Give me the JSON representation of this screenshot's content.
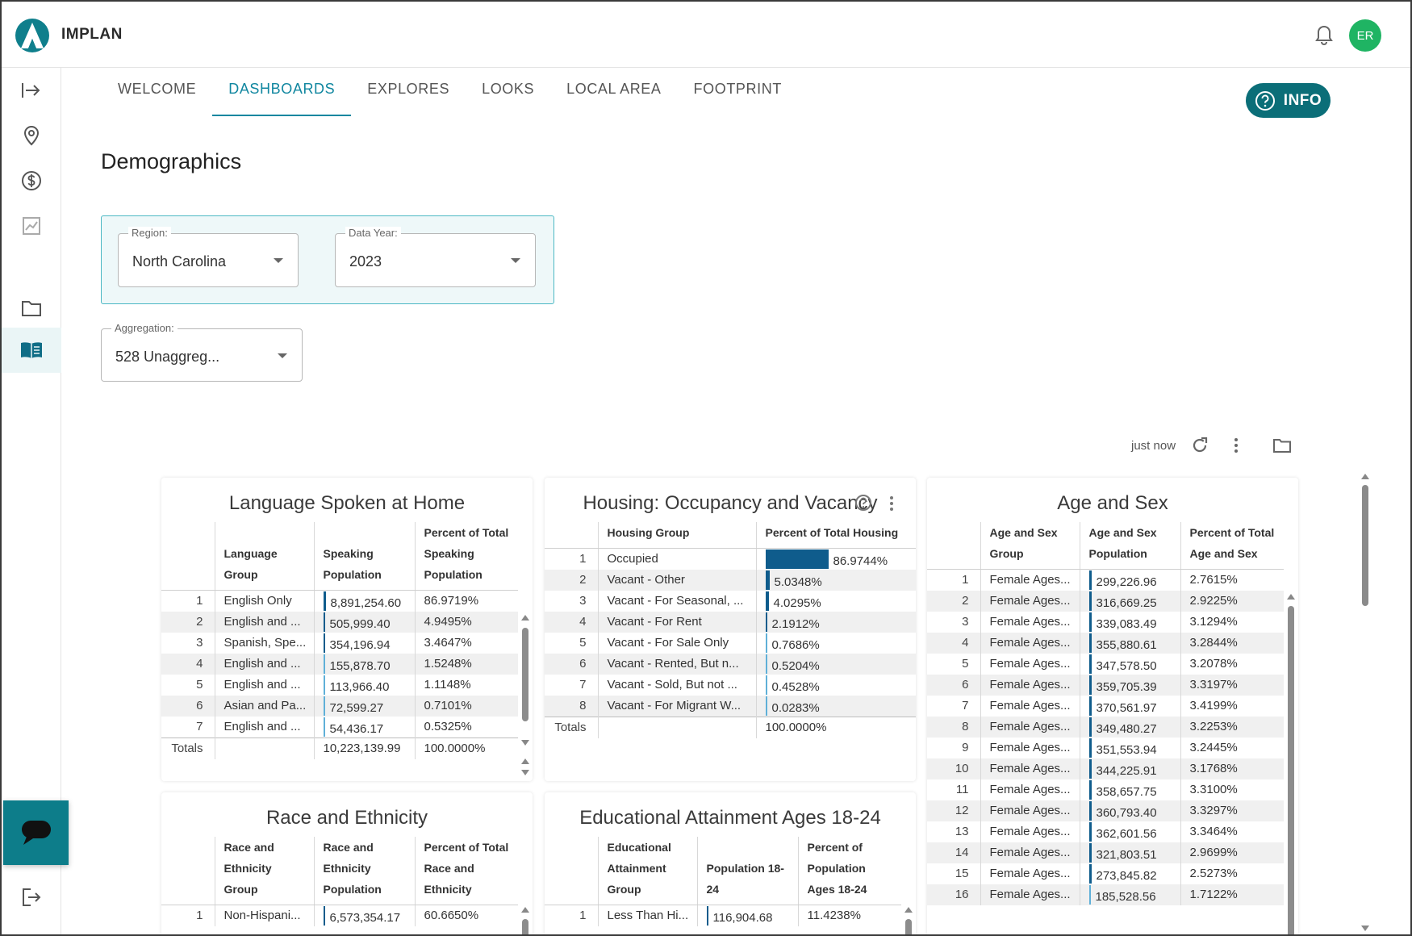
{
  "app": {
    "brand": "IMPLAN",
    "avatar_initials": "ER",
    "accent": "#1187a0",
    "brand_dark": "#0b6e78",
    "avatar_color": "#1fb463"
  },
  "nav": {
    "tabs": [
      "WELCOME",
      "DASHBOARDS",
      "EXPLORES",
      "LOOKS",
      "LOCAL AREA",
      "FOOTPRINT"
    ],
    "active": "DASHBOARDS"
  },
  "info_button": "INFO",
  "page_title": "Demographics",
  "filters": {
    "region": {
      "label": "Region:",
      "value": "North Carolina"
    },
    "data_year": {
      "label": "Data Year:",
      "value": "2023"
    },
    "aggregation": {
      "label": "Aggregation:",
      "value": "528 Unaggreg..."
    }
  },
  "toolbar": {
    "updated": "just now"
  },
  "tiles": {
    "language": {
      "title": "Language Spoken at Home",
      "headers": [
        "Language Group",
        "Speaking Population",
        "Percent of Total Speaking Population"
      ],
      "rows": [
        {
          "n": "1",
          "group": "English Only",
          "pop": "8,891,254.60",
          "pct": "86.9719%",
          "share": 0.8697
        },
        {
          "n": "2",
          "group": "English and ...",
          "pop": "505,999.40",
          "pct": "4.9495%",
          "share": 0.0495
        },
        {
          "n": "3",
          "group": "Spanish, Spe...",
          "pop": "354,196.94",
          "pct": "3.4647%",
          "share": 0.0346
        },
        {
          "n": "4",
          "group": "English and ...",
          "pop": "155,878.70",
          "pct": "1.5248%",
          "share": 0.0152
        },
        {
          "n": "5",
          "group": "English and ...",
          "pop": "113,966.40",
          "pct": "1.1148%",
          "share": 0.0111
        },
        {
          "n": "6",
          "group": "Asian and Pa...",
          "pop": "72,599.27",
          "pct": "0.7101%",
          "share": 0.0071
        },
        {
          "n": "7",
          "group": "English and ...",
          "pop": "54,436.17",
          "pct": "0.5325%",
          "share": 0.0053
        }
      ],
      "totals": {
        "label": "Totals",
        "pop": "10,223,139.99",
        "pct": "100.0000%"
      }
    },
    "housing": {
      "title": "Housing: Occupancy and Vacancy",
      "headers": [
        "Housing Group",
        "Percent of Total Housing"
      ],
      "rows": [
        {
          "n": "1",
          "group": "Occupied",
          "pct": "86.9744%",
          "share": 0.8697
        },
        {
          "n": "2",
          "group": "Vacant - Other",
          "pct": "5.0348%",
          "share": 0.0503
        },
        {
          "n": "3",
          "group": "Vacant - For Seasonal, ...",
          "pct": "4.0295%",
          "share": 0.0403
        },
        {
          "n": "4",
          "group": "Vacant - For Rent",
          "pct": "2.1912%",
          "share": 0.0219
        },
        {
          "n": "5",
          "group": "Vacant - For Sale Only",
          "pct": "0.7686%",
          "share": 0.0077
        },
        {
          "n": "6",
          "group": "Vacant - Rented, But n...",
          "pct": "0.5204%",
          "share": 0.0052
        },
        {
          "n": "7",
          "group": "Vacant - Sold, But not ...",
          "pct": "0.4528%",
          "share": 0.0045
        },
        {
          "n": "8",
          "group": "Vacant - For Migrant W...",
          "pct": "0.0283%",
          "share": 0.0003
        }
      ],
      "totals": {
        "label": "Totals",
        "pct": "100.0000%"
      }
    },
    "age_sex": {
      "title": "Age and Sex",
      "headers": [
        "Age and Sex Group",
        "Age and Sex Population",
        "Percent of Total Age and Sex"
      ],
      "rows": [
        {
          "n": "1",
          "group": "Female Ages...",
          "pop": "299,226.96",
          "pct": "2.7615%",
          "share": 0.0276
        },
        {
          "n": "2",
          "group": "Female Ages...",
          "pop": "316,669.25",
          "pct": "2.9225%",
          "share": 0.0292
        },
        {
          "n": "3",
          "group": "Female Ages...",
          "pop": "339,083.49",
          "pct": "3.1294%",
          "share": 0.0313
        },
        {
          "n": "4",
          "group": "Female Ages...",
          "pop": "355,880.61",
          "pct": "3.2844%",
          "share": 0.0328
        },
        {
          "n": "5",
          "group": "Female Ages...",
          "pop": "347,578.50",
          "pct": "3.2078%",
          "share": 0.0321
        },
        {
          "n": "6",
          "group": "Female Ages...",
          "pop": "359,705.39",
          "pct": "3.3197%",
          "share": 0.0332
        },
        {
          "n": "7",
          "group": "Female Ages...",
          "pop": "370,561.97",
          "pct": "3.4199%",
          "share": 0.0342
        },
        {
          "n": "8",
          "group": "Female Ages...",
          "pop": "349,480.27",
          "pct": "3.2253%",
          "share": 0.0323
        },
        {
          "n": "9",
          "group": "Female Ages...",
          "pop": "351,553.94",
          "pct": "3.2445%",
          "share": 0.0324
        },
        {
          "n": "10",
          "group": "Female Ages...",
          "pop": "344,225.91",
          "pct": "3.1768%",
          "share": 0.0318
        },
        {
          "n": "11",
          "group": "Female Ages...",
          "pop": "358,657.75",
          "pct": "3.3100%",
          "share": 0.0331
        },
        {
          "n": "12",
          "group": "Female Ages...",
          "pop": "360,793.40",
          "pct": "3.3297%",
          "share": 0.0333
        },
        {
          "n": "13",
          "group": "Female Ages...",
          "pop": "362,601.56",
          "pct": "3.3464%",
          "share": 0.0335
        },
        {
          "n": "14",
          "group": "Female Ages...",
          "pop": "321,803.51",
          "pct": "2.9699%",
          "share": 0.0297
        },
        {
          "n": "15",
          "group": "Female Ages...",
          "pop": "273,845.82",
          "pct": "2.5273%",
          "share": 0.0253
        },
        {
          "n": "16",
          "group": "Female Ages...",
          "pop": "185,528.56",
          "pct": "1.7122%",
          "share": 0.0171
        }
      ]
    },
    "race": {
      "title": "Race and Ethnicity",
      "headers": [
        "Race and Ethnicity Group",
        "Race and Ethnicity Population",
        "Percent of Total Race and Ethnicity"
      ],
      "rows": [
        {
          "n": "1",
          "group": "Non-Hispani...",
          "pop": "6,573,354.17",
          "pct": "60.6650%",
          "share": 0.6067
        }
      ]
    },
    "education": {
      "title": "Educational Attainment Ages 18-24",
      "headers": [
        "Educational Attainment Group",
        "Population 18-24",
        "Percent of Population Ages 18-24"
      ],
      "rows": [
        {
          "n": "1",
          "group": "Less Than Hi...",
          "pop": "116,904.68",
          "pct": "11.4238%",
          "share": 0.1142
        }
      ]
    }
  }
}
